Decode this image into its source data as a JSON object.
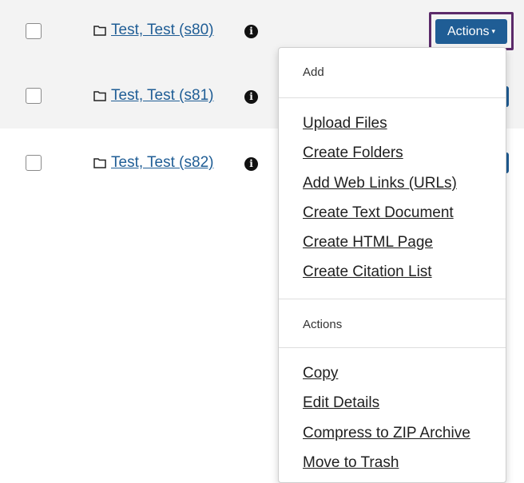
{
  "rows": [
    {
      "label": "Test, Test (s80)",
      "info": "i"
    },
    {
      "label": "Test, Test (s81)",
      "info": "i"
    },
    {
      "label": "Test, Test (s82)",
      "info": "i"
    }
  ],
  "actions_button": {
    "label": "Actions",
    "caret": "▾"
  },
  "menu": {
    "add_header": "Add",
    "add_items": [
      "Upload Files",
      "Create Folders",
      "Add Web Links (URLs)",
      "Create Text Document",
      "Create HTML Page",
      "Create Citation List"
    ],
    "actions_header": "Actions",
    "action_items": [
      "Copy",
      "Edit Details",
      "Compress to ZIP Archive",
      "Move to Trash"
    ]
  }
}
